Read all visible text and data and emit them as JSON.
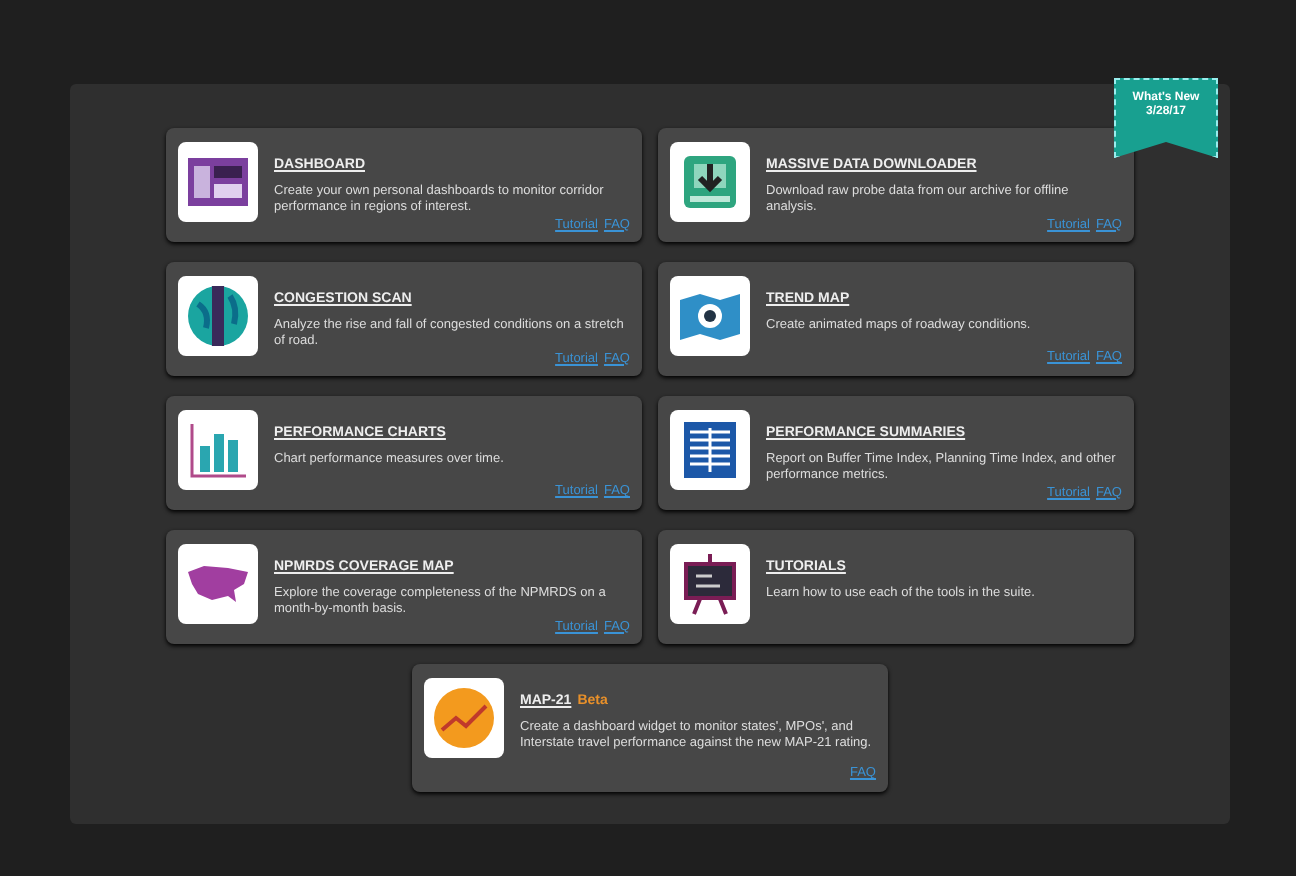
{
  "ribbon": {
    "title": "What's New",
    "date": "3/28/17"
  },
  "tools": [
    {
      "title": "DASHBOARD",
      "description": "Create your own personal dashboards to monitor corridor performance in regions of interest.",
      "links": [
        "Tutorial",
        "FAQ"
      ]
    },
    {
      "title": "MASSIVE DATA DOWNLOADER",
      "description": "Download raw probe data from our archive for offline analysis.",
      "links": [
        "Tutorial",
        "FAQ"
      ]
    },
    {
      "title": "CONGESTION SCAN",
      "description": "Analyze the rise and fall of congested conditions on a stretch of road.",
      "links": [
        "Tutorial",
        "FAQ"
      ]
    },
    {
      "title": "TREND MAP",
      "description": "Create animated maps of roadway conditions.",
      "links": [
        "Tutorial",
        "FAQ"
      ]
    },
    {
      "title": "PERFORMANCE CHARTS",
      "description": "Chart performance measures over time.",
      "links": [
        "Tutorial",
        "FAQ"
      ]
    },
    {
      "title": "PERFORMANCE SUMMARIES",
      "description": "Report on Buffer Time Index, Planning Time Index, and other performance metrics.",
      "links": [
        "Tutorial",
        "FAQ"
      ]
    },
    {
      "title": "NPMRDS COVERAGE MAP",
      "description": "Explore the coverage completeness of the NPMRDS on a month-by-month basis.",
      "links": [
        "Tutorial",
        "FAQ"
      ]
    },
    {
      "title": "TUTORIALS",
      "description": "Learn how to use each of the tools in the suite."
    },
    {
      "title": "MAP-21",
      "badge": "Beta",
      "description": "Create a dashboard widget to monitor states', MPOs', and Interstate travel performance against the new MAP-21 rating.",
      "links": [
        "FAQ"
      ]
    }
  ]
}
